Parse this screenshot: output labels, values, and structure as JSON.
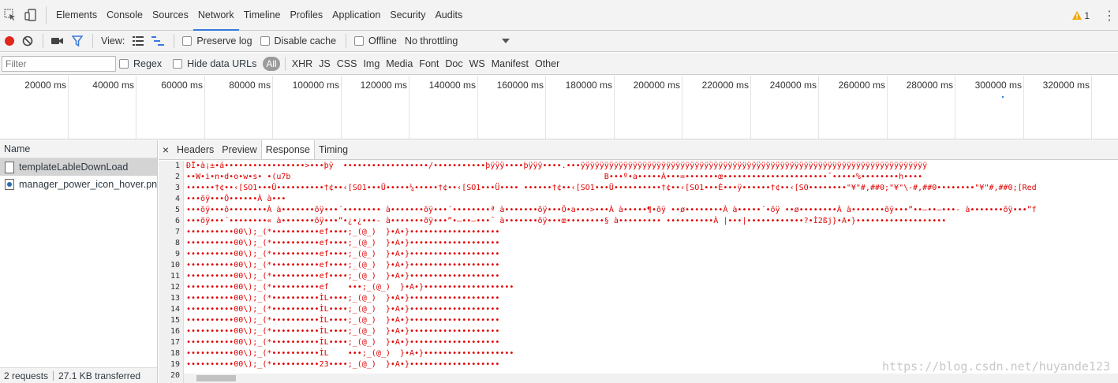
{
  "tabs": [
    "Elements",
    "Console",
    "Sources",
    "Network",
    "Timeline",
    "Profiles",
    "Application",
    "Security",
    "Audits"
  ],
  "active_tab": "Network",
  "warning_count": "1",
  "toolbar": {
    "view_label": "View:",
    "preserve_log": "Preserve log",
    "disable_cache": "Disable cache",
    "offline": "Offline",
    "throttling": "No throttling"
  },
  "filter": {
    "placeholder": "Filter",
    "regex": "Regex",
    "hide_data_urls": "Hide data URLs",
    "types": [
      "All",
      "XHR",
      "JS",
      "CSS",
      "Img",
      "Media",
      "Font",
      "Doc",
      "WS",
      "Manifest",
      "Other"
    ]
  },
  "overview_ticks": [
    "20000 ms",
    "40000 ms",
    "60000 ms",
    "80000 ms",
    "100000 ms",
    "120000 ms",
    "140000 ms",
    "160000 ms",
    "180000 ms",
    "200000 ms",
    "220000 ms",
    "240000 ms",
    "260000 ms",
    "280000 ms",
    "300000 ms",
    "320000 ms",
    "34"
  ],
  "requests": {
    "header": "Name",
    "items": [
      {
        "name": "templateLableDownLoad",
        "type": "doc",
        "selected": true
      },
      {
        "name": "manager_power_icon_hover.png",
        "type": "img",
        "selected": false
      }
    ],
    "count": "2 requests",
    "transferred": "27.1 KB transferred"
  },
  "detail_tabs": [
    "Headers",
    "Preview",
    "Response",
    "Timing"
  ],
  "active_detail_tab": "Response",
  "response_lines": [
    "ÐÏ•à¡±•á•••••••••••••••••>•••þÿ  ••••••••••••••••••/•••••••••••þÿÿÿ••••þÿÿÿ••••.•••ÿÿÿÿÿÿÿÿÿÿÿÿÿÿÿÿÿÿÿÿÿÿÿÿÿÿÿÿÿÿÿÿÿÿÿÿÿÿÿÿÿÿÿÿÿÿÿÿÿÿÿÿÿÿÿÿÿÿÿÿÿÿÿÿÿÿÿÿÿÿÿÿÿ",
    "••W•i•n•d•o•w•s• •(u7b                                                                  B•••º•a•••••À•••=•••••••œ••••••••••••••••••••••¯•••••%••••••••h••••",
    "••••••†¢••‹[SO1•••Ü••••••••••†¢••‹[SO1•••Ü•••••¼•••••†¢••‹[SO1•••Ü•••• ••••••†¢••‹[SO1•••Ü••••••••••†¢••‹[SO1•••È•••ÿ••••••†¢••‹[SO••••••••\"¥\"#,##0;\"¥\"\\-#,##0••••••••\"¥\"#,##0;[Red",
    "•••õÿ•••Ô••••••À à•••",
    "•••õÿ•••ô••••••••À à•••••••õÿ•••´•••••••• à•••••••õÿ•••´••••••••ª à•••••••õÿ•••Ô•a•••>•••À à•••••¶•õÿ ••ø••••••••À à•••••´•õÿ ••ø••••••••À à•••••••õÿ•••”••—••—•••- à•••••••õÿ•••”f",
    "•••õÿ•••´••••••••« à•••••••õÿ•••”•¿•¿•••- à•••••••õÿ•••”•—••—•••¯ à•••••••õÿ•••œ••••••••§ à••••••••• ••••••••••À |•••|••••••••••••?•Ì2ßj}•A•}•••••••••••••••••••",
    "••••••••••00\\);_(*••••••••••ef••••;_(@_)  }•A•}•••••••••••••••••••",
    "••••••••••00\\);_(*••••••••••ef••••;_(@_)  }•A•}•••••••••••••••••••",
    "••••••••••00\\);_(*••••••••••ef••••;_(@_)  }•A•}•••••••••••••••••••",
    "••••••••••00\\);_(*••••••••••ef••••;_(@_)  }•A•}•••••••••••••••••••",
    "••••••••••00\\);_(*••••••••••ef••••;_(@_)  }•A•}•••••••••••••••••••",
    "••••••••••00\\);_(*••••••••••ef    •••;_(@_)  }•A•}•••••••••••••••••••",
    "••••••••••00\\);_(*••••••••••ÌL••••;_(@_)  }•A•}•••••••••••••••••••",
    "••••••••••00\\);_(*••••••••••ÌL••••;_(@_)  }•A•}•••••••••••••••••••",
    "••••••••••00\\);_(*••••••••••ÌL••••;_(@_)  }•A•}•••••••••••••••••••",
    "••••••••••00\\);_(*••••••••••ÌL••••;_(@_)  }•A•}•••••••••••••••••••",
    "••••••••••00\\);_(*••••••••••ÌL••••;_(@_)  }•A•}•••••••••••••••••••",
    "••••••••••00\\);_(*••••••••••ÌL    •••;_(@_)  }•A•}•••••••••••••••••••",
    "••••••••••00\\);_(*••••••••••23••••;_(@_)  }•A•}•••••••••••••••••••",
    ""
  ],
  "watermark": "https://blog.csdn.net/huyande123",
  "colors": {
    "accent": "#3879d9",
    "record": "#e0261d",
    "response_text": "#e00000",
    "warning": "#f2a600"
  }
}
